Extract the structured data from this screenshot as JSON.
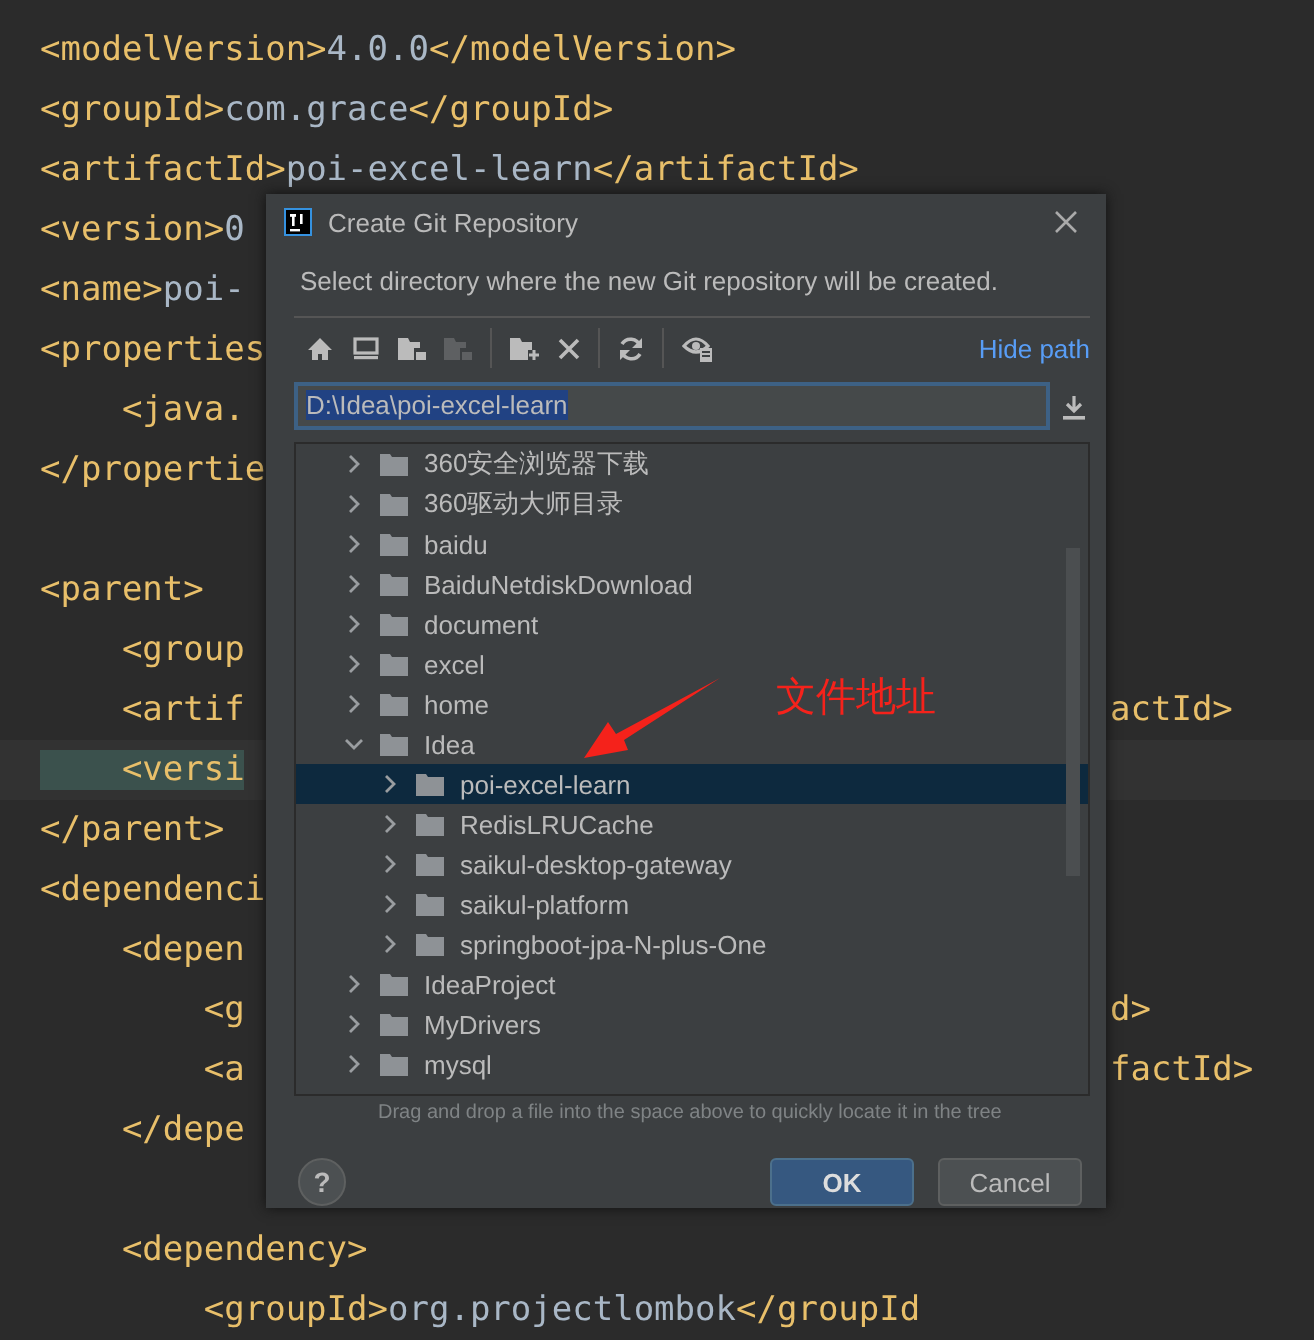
{
  "editor": {
    "lines": [
      {
        "parts": [
          {
            "kind": "tag",
            "text": "<modelVersion>"
          },
          {
            "kind": "value",
            "text": "4.0.0"
          },
          {
            "kind": "tag",
            "text": "</modelVersion>"
          }
        ]
      },
      {
        "parts": [
          {
            "kind": "tag",
            "text": "<groupId>"
          },
          {
            "kind": "value",
            "text": "com.grace"
          },
          {
            "kind": "tag",
            "text": "</groupId>"
          }
        ]
      },
      {
        "parts": [
          {
            "kind": "tag",
            "text": "<artifactId>"
          },
          {
            "kind": "value",
            "text": "poi-excel-learn"
          },
          {
            "kind": "tag",
            "text": "</artifactId>"
          }
        ]
      },
      {
        "parts": [
          {
            "kind": "tag",
            "text": "<version>"
          },
          {
            "kind": "value",
            "text": "0"
          }
        ]
      },
      {
        "parts": [
          {
            "kind": "tag",
            "text": "<name>"
          },
          {
            "kind": "value",
            "text": "poi-"
          }
        ]
      },
      {
        "parts": [
          {
            "kind": "tag",
            "text": "<properties"
          }
        ]
      },
      {
        "parts": [
          {
            "kind": "tag",
            "text": "    <java."
          }
        ]
      },
      {
        "parts": [
          {
            "kind": "tag",
            "text": "</propertie"
          }
        ]
      },
      {
        "blank_before": true,
        "parts": [
          {
            "kind": "tag",
            "text": "<parent>"
          }
        ]
      },
      {
        "parts": [
          {
            "kind": "tag",
            "text": "    <group"
          }
        ]
      },
      {
        "parts": [
          {
            "kind": "tag",
            "text": "    <artif"
          }
        ],
        "tail": "actId>"
      },
      {
        "current": true,
        "parts": [
          {
            "kind": "tag",
            "text": "    <versi"
          }
        ]
      },
      {
        "parts": [
          {
            "kind": "tag",
            "text": "</parent>"
          }
        ]
      },
      {
        "parts": [
          {
            "kind": "tag",
            "text": "<dependenci"
          }
        ]
      },
      {
        "parts": [
          {
            "kind": "tag",
            "text": "    <depen"
          }
        ]
      },
      {
        "parts": [
          {
            "kind": "tag",
            "text": "        <g"
          }
        ],
        "tail": "d>"
      },
      {
        "parts": [
          {
            "kind": "tag",
            "text": "        <a"
          }
        ],
        "tail": "factId>"
      },
      {
        "parts": [
          {
            "kind": "tag",
            "text": "    </depe"
          }
        ]
      },
      {
        "blank_before": true,
        "parts": [
          {
            "kind": "tag",
            "text": "    <dependency>"
          }
        ]
      },
      {
        "parts": [
          {
            "kind": "tag",
            "text": "        <groupId>"
          },
          {
            "kind": "value",
            "text": "org.projectlombok"
          },
          {
            "kind": "tag",
            "text": "</groupId"
          }
        ]
      }
    ]
  },
  "dialog": {
    "title": "Create Git Repository",
    "description": "Select directory where the new Git repository will be created.",
    "hide_path": "Hide path",
    "path": "D:\\Idea\\poi-excel-learn",
    "tree": {
      "items": [
        {
          "label": "360安全浏览器下载",
          "expanded": false,
          "selected": false
        },
        {
          "label": "360驱动大师目录",
          "expanded": false,
          "selected": false
        },
        {
          "label": "baidu",
          "expanded": false,
          "selected": false
        },
        {
          "label": "BaiduNetdiskDownload",
          "expanded": false,
          "selected": false
        },
        {
          "label": "document",
          "expanded": false,
          "selected": false
        },
        {
          "label": "excel",
          "expanded": false,
          "selected": false
        },
        {
          "label": "home",
          "expanded": false,
          "selected": false
        },
        {
          "label": "Idea",
          "expanded": true,
          "selected": false,
          "children": [
            {
              "label": "poi-excel-learn",
              "expanded": false,
              "selected": true
            },
            {
              "label": "RedisLRUCache",
              "expanded": false,
              "selected": false
            },
            {
              "label": "saikul-desktop-gateway",
              "expanded": false,
              "selected": false
            },
            {
              "label": "saikul-platform",
              "expanded": false,
              "selected": false
            },
            {
              "label": "springboot-jpa-N-plus-One",
              "expanded": false,
              "selected": false
            }
          ]
        },
        {
          "label": "IdeaProject",
          "expanded": false,
          "selected": false
        },
        {
          "label": "MyDrivers",
          "expanded": false,
          "selected": false
        },
        {
          "label": "mysql",
          "expanded": false,
          "selected": false
        }
      ]
    },
    "hint": "Drag and drop a file into the space above to quickly locate it in the tree",
    "help": "?",
    "buttons": [
      {
        "label": "OK",
        "kind": "primary"
      },
      {
        "label": "Cancel",
        "kind": "secondary"
      }
    ]
  },
  "annotation": {
    "text": "文件地址"
  }
}
